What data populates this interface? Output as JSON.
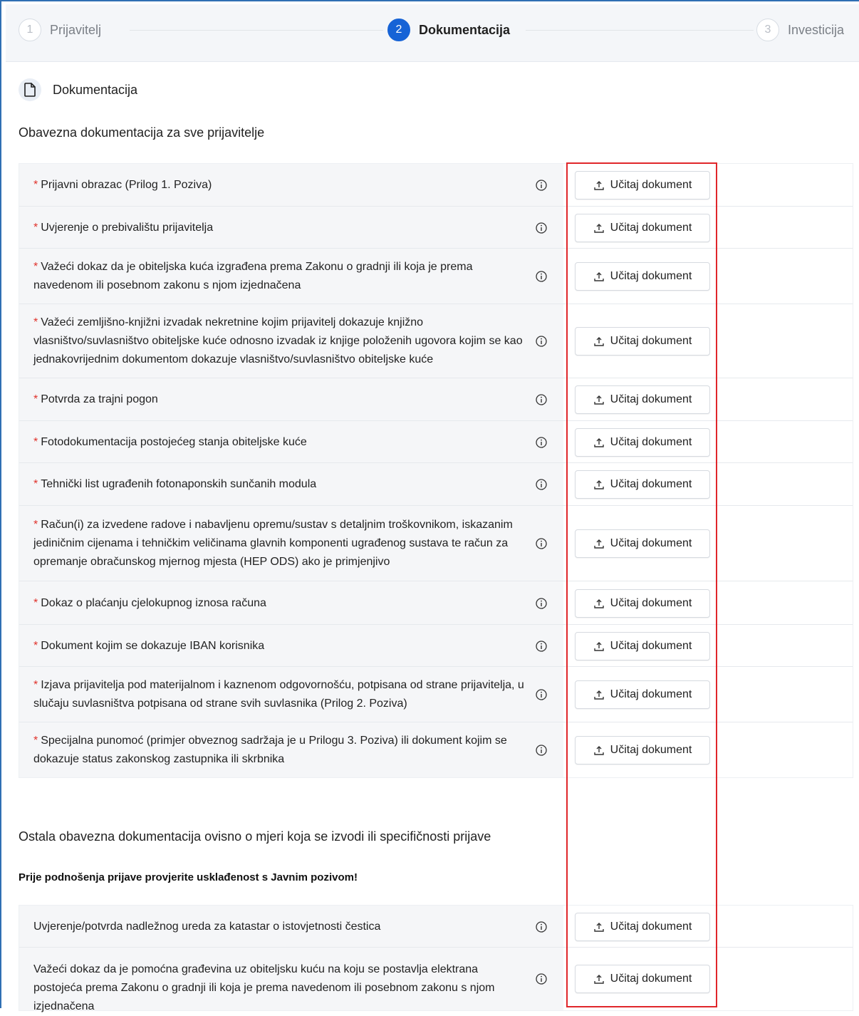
{
  "stepper": {
    "steps": [
      {
        "num": "1",
        "label": "Prijavitelj"
      },
      {
        "num": "2",
        "label": "Dokumentacija"
      },
      {
        "num": "3",
        "label": "Investicija"
      }
    ]
  },
  "section": {
    "title": "Dokumentacija",
    "icon": "document-icon"
  },
  "group1": {
    "title": "Obavezna dokumentacija za sve prijavitelje",
    "rows": [
      {
        "text": "Prijavni obrazac (Prilog 1. Poziva)"
      },
      {
        "text": "Uvjerenje o prebivalištu prijavitelja"
      },
      {
        "text": "Važeći dokaz da je obiteljska kuća izgrađena prema Zakonu o gradnji ili koja je prema navedenom ili posebnom zakonu s njom izjednačena"
      },
      {
        "text": "Važeći zemljišno-knjižni izvadak nekretnine kojim prijavitelj dokazuje knjižno vlasništvo/suvlasništvo obiteljske kuće odnosno izvadak iz knjige položenih ugovora kojim se kao jednakovrijednim dokumentom dokazuje vlasništvo/suvlasništvo obiteljske kuće"
      },
      {
        "text": "Potvrda za trajni pogon"
      },
      {
        "text": "Fotodokumentacija postojećeg stanja obiteljske kuće"
      },
      {
        "text": "Tehnički list ugrađenih fotonaponskih sunčanih modula"
      },
      {
        "text": "Račun(i) za izvedene radove i nabavljenu opremu/sustav s detaljnim troškovnikom, iskazanim jediničnim cijenama i tehničkim veličinama glavnih komponenti ugrađenog sustava te račun za opremanje obračunskog mjernog mjesta (HEP ODS) ako je primjenjivo"
      },
      {
        "text": "Dokaz o plaćanju cjelokupnog iznosa računa"
      },
      {
        "text": "Dokument kojim se dokazuje IBAN korisnika"
      },
      {
        "text": "Izjava prijavitelja pod materijalnom i kaznenom odgovornošću, potpisana od strane prijavitelja, u slučaju suvlasništva potpisana od strane svih suvlasnika (Prilog 2. Poziva)"
      },
      {
        "text": "Specijalna punomoć (primjer obveznog sadržaja je u Prilogu 3. Poziva) ili dokument kojim se dokazuje status zakonskog zastupnika ili skrbnika"
      }
    ]
  },
  "group2": {
    "title": "Ostala obavezna dokumentacija ovisno o mjeri koja se izvodi ili specifičnosti prijave",
    "notice": "Prije podnošenja prijave provjerite usklađenost s Javnim pozivom!",
    "rows": [
      {
        "text": "Uvjerenje/potvrda nadležnog ureda za katastar o istovjetnosti čestica"
      },
      {
        "text": "Važeći dokaz da je pomoćna građevina uz obiteljsku kuću na koju se postavlja elektrana postojeća prema Zakonu o gradnji ili koja je prema navedenom ili posebnom zakonu s njom izjednačena"
      }
    ]
  },
  "upload_label": "Učitaj dokument",
  "required_marker": "*",
  "colors": {
    "accent": "#1663d6",
    "required": "#e0322b",
    "highlight": "#e0262a"
  }
}
